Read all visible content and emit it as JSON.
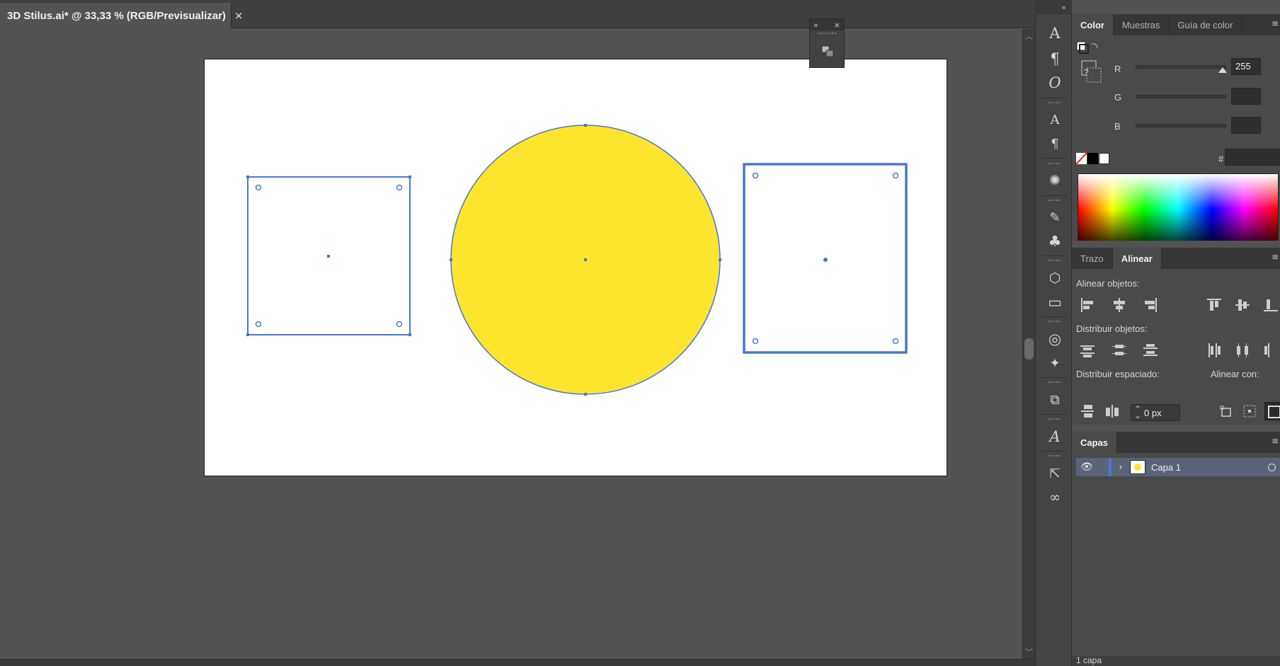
{
  "document_tab": {
    "title": "3D Stilus.ai* @ 33,33 % (RGB/Previsualizar)",
    "close_icon": "×"
  },
  "canvas": {
    "artboard_color": "#ffffff",
    "objects": [
      {
        "name": "square-left",
        "type": "rect",
        "fill": "none",
        "stroke": "#4a76d6",
        "selected": true
      },
      {
        "name": "yellow-circle",
        "type": "ellipse",
        "fill": "#ffe52e",
        "stroke": "#4a76d6",
        "selected": true
      },
      {
        "name": "square-right",
        "type": "rect",
        "fill": "none",
        "stroke": "#4a76d6",
        "selected": true
      }
    ]
  },
  "float_panel": {
    "expand_icon": "»",
    "close_icon": "×"
  },
  "dock": {
    "collapse_icon": "«"
  },
  "tools": [
    {
      "name": "character-icon",
      "glyph": "A|"
    },
    {
      "name": "paragraph-icon",
      "glyph": "¶"
    },
    {
      "name": "opentype-icon",
      "glyph": "O"
    },
    {
      "name": "glyphs-icon",
      "glyph": "A"
    },
    {
      "name": "paragraph-styles-icon",
      "glyph": "¶"
    },
    {
      "name": "symbols-icon",
      "glyph": "✺"
    },
    {
      "name": "brushes-icon",
      "glyph": "✎"
    },
    {
      "name": "club-icon",
      "glyph": "♣"
    },
    {
      "name": "3d-icon",
      "glyph": "⬡"
    },
    {
      "name": "gradient-icon",
      "glyph": "▭"
    },
    {
      "name": "transparency-icon",
      "glyph": "◎"
    },
    {
      "name": "magic-wand-icon",
      "glyph": "✦"
    },
    {
      "name": "transform-icon",
      "glyph": "⧉"
    },
    {
      "name": "char-styles-icon",
      "glyph": "𝒜"
    },
    {
      "name": "export-icon",
      "glyph": "⇱"
    },
    {
      "name": "links-icon",
      "glyph": "∞"
    }
  ],
  "color_panel": {
    "tabs": [
      "Color",
      "Muestras",
      "Guía de color"
    ],
    "active_tab": "Color",
    "r_label": "R",
    "g_label": "G",
    "b_label": "B",
    "r_value": "255",
    "g_value": "",
    "b_value": "",
    "r_level": 0.97,
    "hash_label": "#",
    "hex_value": "",
    "question_mark": "?"
  },
  "align_panel": {
    "tabs": [
      "Trazo",
      "Alinear"
    ],
    "active_tab": "Alinear",
    "align_objects_label": "Alinear objetos:",
    "distribute_objects_label": "Distribuir objetos:",
    "distribute_spacing_label": "Distribuir espaciado:",
    "align_to_label": "Alinear con:",
    "spacing_value": "0 px"
  },
  "layers_panel": {
    "tab": "Capas",
    "layers": [
      {
        "name": "Capa 1",
        "color": "#4a76d6"
      }
    ],
    "footer_count": "1 capa"
  },
  "panel_menu_icon": "≡"
}
